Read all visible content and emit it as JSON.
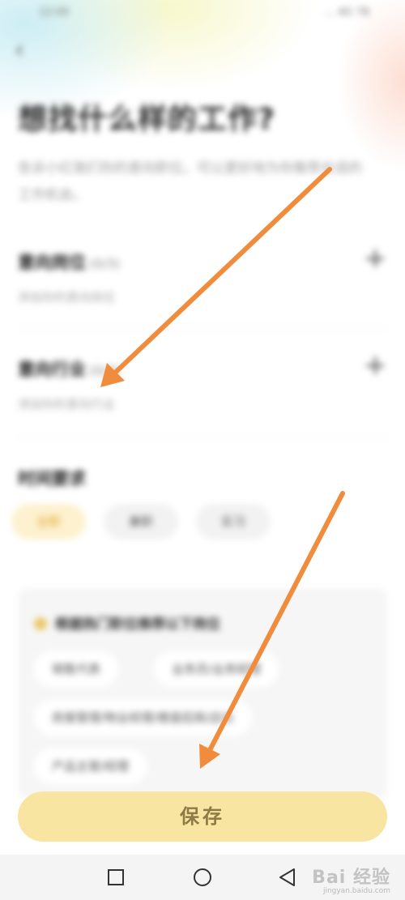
{
  "status_bar": {
    "time": "12:00",
    "icons": "... 4G 78"
  },
  "header": {
    "back_label": "‹"
  },
  "page": {
    "title": "想找什么样的工作?",
    "description": "告诉小红我们你的意向职位，可以更好地为你推荐合适的工作机会。"
  },
  "intent_job": {
    "title": "意向岗位",
    "count": "(0/3)",
    "hint": "添加你的意向岗位"
  },
  "intent_industry": {
    "title": "意向行业",
    "count": "(0/3)",
    "hint": "添加你的意向行业"
  },
  "work_time": {
    "title": "时间要求",
    "options": [
      {
        "label": "全职",
        "selected": true
      },
      {
        "label": "兼职",
        "selected": false
      },
      {
        "label": "实习",
        "selected": false
      }
    ]
  },
  "suggestions": {
    "header": "根据热门职位推荐以下岗位",
    "chips": [
      "销售代表",
      "业务员/业务经理",
      "房屋管理/物业经理/楼盘招商/店长",
      "产品主管/经理"
    ]
  },
  "save_label": "保存",
  "nav": {
    "recent_icon": "square-icon",
    "home_icon": "circle-icon",
    "back_icon": "triangle-back-icon"
  },
  "watermark": {
    "main": "Bai 经验",
    "sub": "jingyan.baidu.com"
  },
  "colors": {
    "accent": "#f8e5a2",
    "annotation_arrow": "#f08c3c",
    "selected_chip": "#e2a42a"
  }
}
